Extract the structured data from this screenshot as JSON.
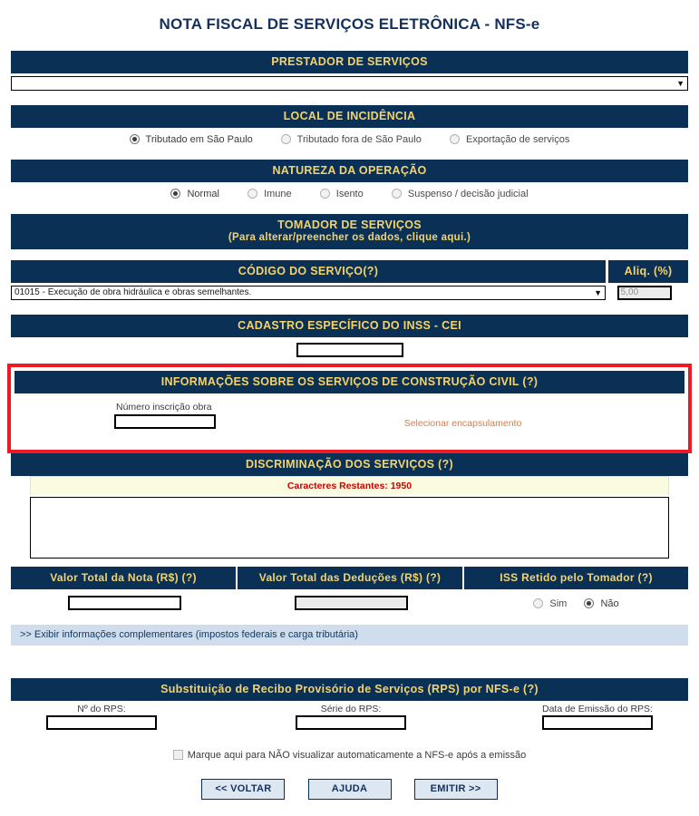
{
  "page": {
    "title": "NOTA FISCAL DE SERVIÇOS ELETRÔNICA - NFS-e"
  },
  "prestador": {
    "header": "PRESTADOR DE SERVIÇOS",
    "select_value": "",
    "arrow_icon": "▼"
  },
  "local_incidencia": {
    "header": "LOCAL DE INCIDÊNCIA",
    "options": [
      {
        "label": "Tributado em São Paulo",
        "selected": true
      },
      {
        "label": "Tributado fora de São Paulo",
        "selected": false
      },
      {
        "label": "Exportação de serviços",
        "selected": false
      }
    ]
  },
  "natureza_operacao": {
    "header": "NATUREZA DA OPERAÇÃO",
    "options": [
      {
        "label": "Normal",
        "selected": true
      },
      {
        "label": "Imune",
        "selected": false
      },
      {
        "label": "Isento",
        "selected": false
      },
      {
        "label": "Suspenso / decisão judicial",
        "selected": false
      }
    ]
  },
  "tomador": {
    "header": "TOMADOR DE SERVIÇOS",
    "subheader": "(Para alterar/preencher os dados, clique aqui.)"
  },
  "codigo_servico": {
    "header": "CÓDIGO DO SERVIÇO",
    "help": "(?)",
    "select_value": "01015 - Execução de obra hidráulica e obras semelhantes.",
    "arrow_icon": "▼",
    "aliq_header": "Aliq. (%)",
    "aliq_value": "5,00"
  },
  "cei": {
    "header": "CADASTRO ESPECÍFICO DO INSS - CEI",
    "value": ""
  },
  "construcao_civil": {
    "header": "INFORMAÇÕES SOBRE OS SERVIÇOS DE CONSTRUÇÃO CIVIL",
    "help": "(?)",
    "obra_label": "Número inscrição obra",
    "obra_value": "",
    "encapsulamento_link": "Selecionar encapsulamento",
    "highlight_color": "#ee1b24"
  },
  "discriminacao": {
    "header": "DISCRIMINAÇÃO DOS SERVIÇOS",
    "help": "(?)",
    "caracteres_restantes": "Caracteres Restantes: 1950",
    "textarea_value": ""
  },
  "totais": {
    "col1_header": "Valor Total da Nota (R$) (?)",
    "col1_value": "",
    "col2_header": "Valor Total das Deduções (R$) (?)",
    "col2_value": "",
    "col3_header": "ISS Retido pelo Tomador (?)",
    "iss_options": [
      {
        "label": "Sim",
        "selected": false
      },
      {
        "label": "Não",
        "selected": true
      }
    ]
  },
  "expander": {
    "label": ">> Exibir informações complementares (impostos federais e carga tributária)"
  },
  "rps": {
    "header": "Substituição de Recibo Provisório de Serviços (RPS) por NFS-e",
    "help": "(?)",
    "fields": [
      {
        "label": "Nº do RPS:",
        "value": ""
      },
      {
        "label": "Série do RPS:",
        "value": ""
      },
      {
        "label": "Data de Emissão do RPS:",
        "value": ""
      }
    ]
  },
  "checkbox": {
    "label": "Marque aqui para NÃO visualizar automaticamente a NFS-e após a emissão",
    "checked": false
  },
  "buttons": [
    {
      "label": "<< VOLTAR"
    },
    {
      "label": "AJUDA"
    },
    {
      "label": "EMITIR >>"
    }
  ],
  "colors": {
    "header_bar": "#0a3055",
    "header_text": "#f5d36b",
    "title": "#13315c",
    "highlight": "#ee1b24",
    "warning_text": "#cc0000",
    "link_orange": "#e07b3c",
    "expander_bg": "#cfdded"
  }
}
